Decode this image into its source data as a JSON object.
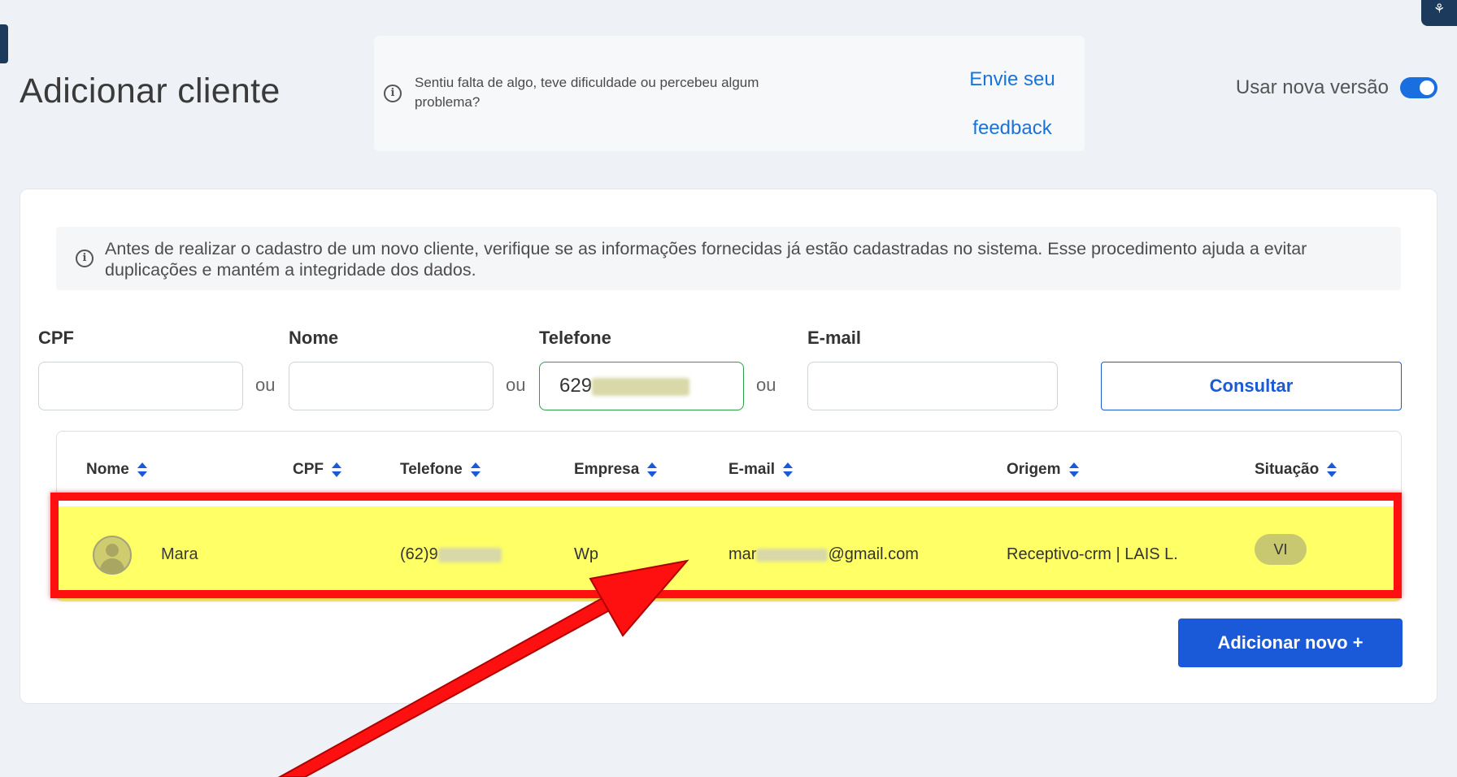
{
  "page": {
    "title": "Adicionar cliente"
  },
  "feedback": {
    "text": "Sentiu falta de algo, teve dificuldade ou percebeu algum problema?",
    "link_line1": "Envie seu",
    "link_line2": "feedback"
  },
  "version_toggle": {
    "label": "Usar nova versão",
    "enabled": true
  },
  "notice": {
    "text": "Antes de realizar o cadastro de um novo cliente, verifique se as informações fornecidas já estão cadastradas no sistema. Esse procedimento ajuda a evitar duplicações e mantém a integridade dos dados."
  },
  "search": {
    "cpf_label": "CPF",
    "nome_label": "Nome",
    "telefone_label": "Telefone",
    "email_label": "E-mail",
    "separator": "ou",
    "telefone_value": "629",
    "consult_label": "Consultar"
  },
  "table": {
    "headers": [
      "Nome",
      "CPF",
      "Telefone",
      "Empresa",
      "E-mail",
      "Origem",
      "Situação"
    ],
    "row": {
      "nome": "Mara",
      "cpf": "",
      "telefone": "(62)9",
      "empresa": "Wp",
      "email_prefix": "mar",
      "email_suffix": "@gmail.com",
      "origem": "Receptivo-crm | LAIS L.",
      "situacao": "VI"
    }
  },
  "add_button": {
    "label": "Adicionar novo  +"
  },
  "colors": {
    "primary": "#1a5ad8",
    "highlight_fill": "#ffff66",
    "highlight_border": "#ff1010",
    "active_input": "#2e9e4a"
  }
}
